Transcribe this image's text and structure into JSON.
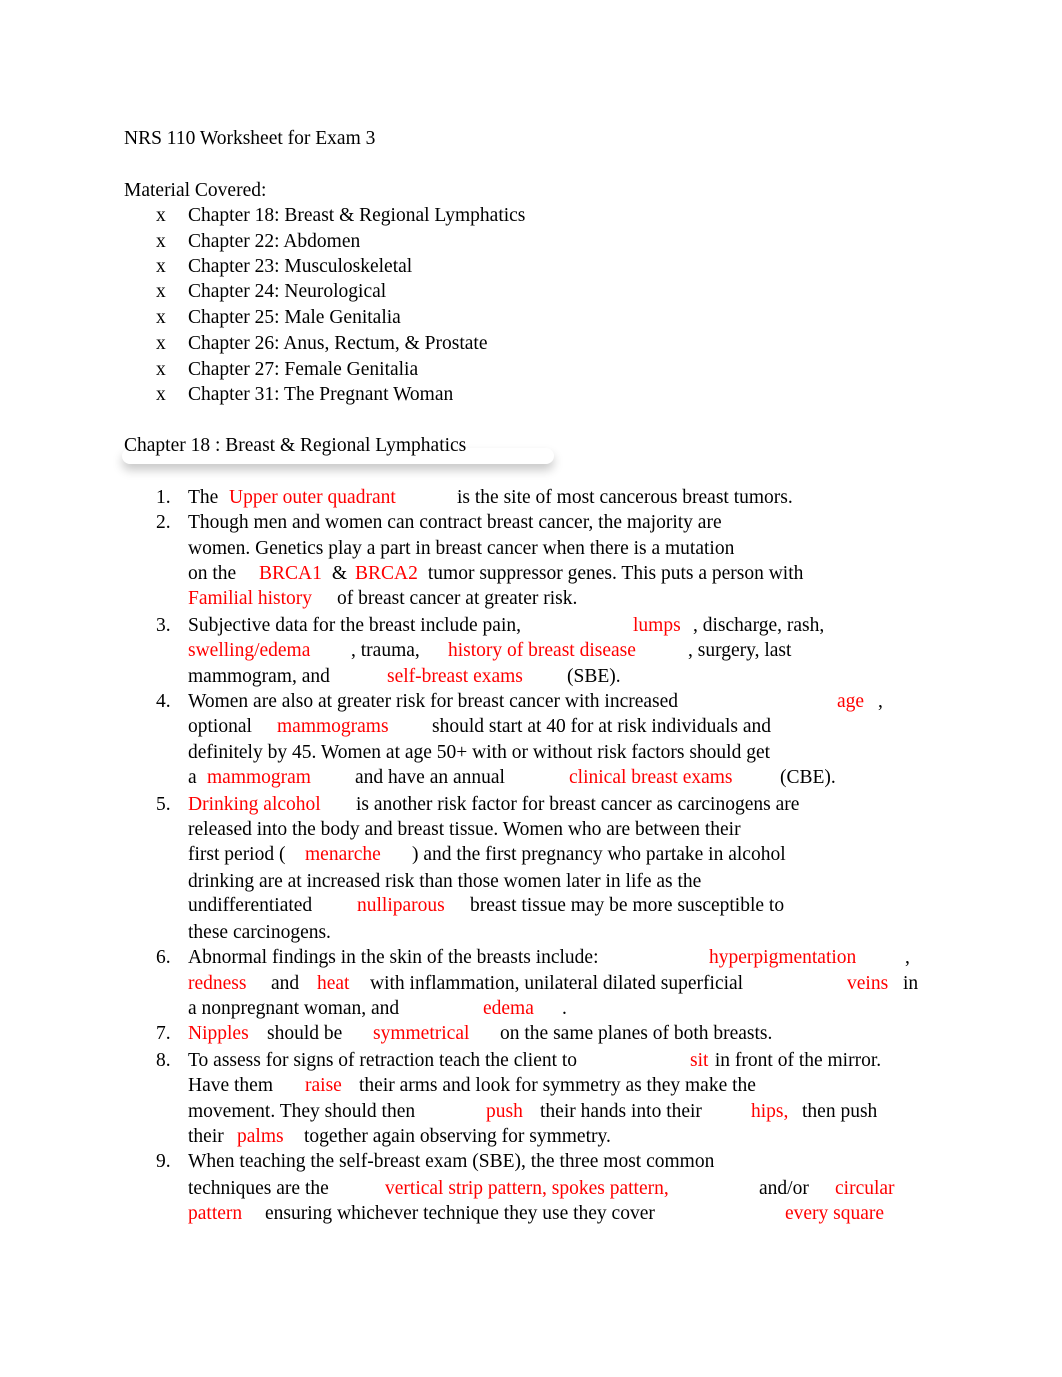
{
  "document": {
    "title": "NRS 110 Worksheet for Exam 3",
    "material_heading": "Material Covered:",
    "bullet_glyph": "x",
    "material": [
      "Chapter 18: Breast & Regional Lymphatics",
      "Chapter 22: Abdomen",
      "Chapter 23: Musculoskeletal",
      "Chapter 24: Neurological",
      "Chapter 25: Male Genitalia",
      "Chapter 26: Anus, Rectum, & Prostate",
      "Chapter 27: Female Genitalia",
      "Chapter 31: The Pregnant Woman"
    ],
    "section_heading": "Chapter 18 : Breast & Regional Lymphatics",
    "answer_color": "#ff0000",
    "questions": [
      {
        "number": "1.",
        "lines": [
          [
            "The ",
            {
              "a": "Upper outer quadrant"
            },
            "is the site of most cancerous breast tumors."
          ]
        ]
      },
      {
        "number": "2.",
        "lines": [
          [
            "Though men and women can contract breast cancer, the majority are"
          ],
          [
            "women. Genetics play a part in breast cancer when there is a mutation"
          ],
          [
            "on the ",
            {
              "a": "BRCA1"
            },
            " & ",
            {
              "a": "BRCA2"
            },
            " tumor suppressor genes. This puts a person with"
          ],
          [
            {
              "a": "Familial history"
            },
            "of breast cancer at greater risk."
          ]
        ]
      },
      {
        "number": "3.",
        "lines": [
          [
            "Subjective data for the breast include pain,",
            {
              "a": "lumps"
            },
            ", discharge, rash,"
          ],
          [
            {
              "a": "swelling/edema"
            },
            ", trauma,",
            {
              "a": "history of breast disease"
            },
            ", surgery, last"
          ],
          [
            "mammogram, and",
            {
              "a": "self-breast exams"
            },
            "(SBE)."
          ]
        ]
      },
      {
        "number": "4.",
        "lines": [
          [
            "Women are also at greater risk for breast cancer with increased",
            {
              "a": "age"
            },
            ","
          ],
          [
            "optional",
            {
              "a": "mammograms"
            },
            "should start at 40 for at risk individuals and"
          ],
          [
            "definitely by 45. Women at age 50+ with or without risk factors should get"
          ],
          [
            "a ",
            {
              "a": "mammogram"
            },
            "and have an annual",
            {
              "a": "clinical breast exams"
            },
            "(CBE)."
          ]
        ]
      },
      {
        "number": "5.",
        "lines": [
          [
            {
              "a": "Drinking alcohol"
            },
            "is another risk factor for breast cancer as carcinogens are"
          ],
          [
            "released into the body and breast tissue. Women who are between their"
          ],
          [
            "first period (",
            {
              "a": "menarche"
            },
            ") and the first pregnancy who partake in alcohol"
          ],
          [
            "drinking are at increased risk than those women later in life as the"
          ],
          [
            "undifferentiated",
            {
              "a": "nulliparous"
            },
            "breast tissue may be more susceptible to"
          ],
          [
            "these carcinogens."
          ]
        ]
      },
      {
        "number": "6.",
        "lines": [
          [
            "Abnormal findings in the skin of the breasts include:",
            {
              "a": "hyperpigmentation"
            },
            ","
          ],
          [
            {
              "a": "redness"
            },
            "and",
            {
              "a": "heat"
            },
            "with inflammation, unilateral dilated superficial",
            {
              "a": "veins"
            },
            "in"
          ],
          [
            "a nonpregnant woman, and",
            {
              "a": "edema"
            },
            "."
          ]
        ]
      },
      {
        "number": "7.",
        "lines": [
          [
            {
              "a": "Nipples"
            },
            "should be",
            {
              "a": "symmetrical"
            },
            "on the same planes of both breasts."
          ]
        ]
      },
      {
        "number": "8.",
        "lines": [
          [
            "To assess for signs of retraction teach the client to",
            {
              "a": "sit"
            },
            " in front of the mirror."
          ],
          [
            "Have them",
            {
              "a": "raise"
            },
            "their arms and look for symmetry as they make the"
          ],
          [
            "movement. They should then",
            {
              "a": "push"
            },
            "their hands into their",
            {
              "a": "hips,"
            },
            "then push"
          ],
          [
            "their ",
            {
              "a": "palms"
            },
            "together again observing for symmetry."
          ]
        ]
      },
      {
        "number": "9.",
        "lines": [
          [
            "When teaching the self-breast exam (SBE), the three most common"
          ],
          [
            "techniques are the",
            {
              "a": "vertical strip pattern, spokes pattern,"
            },
            "and/or",
            {
              "a": "circular"
            }
          ],
          [
            {
              "a": "pattern"
            },
            "ensuring whichever technique they use they cover",
            {
              "a": "every square"
            }
          ]
        ]
      }
    ]
  }
}
